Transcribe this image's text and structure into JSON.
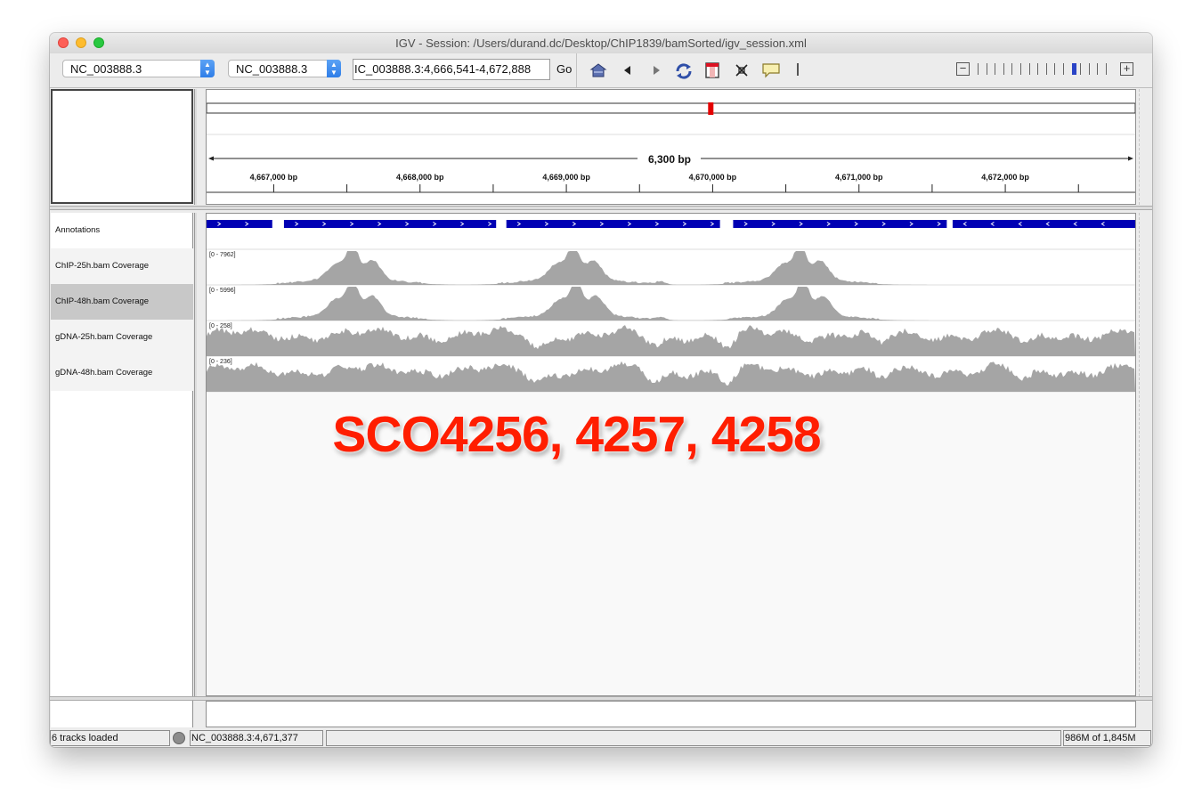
{
  "window": {
    "title": "IGV - Session: /Users/durand.dc/Desktop/ChIP1839/bamSorted/igv_session.xml"
  },
  "toolbar": {
    "genome_select": "NC_003888.3",
    "chromosome_select": "NC_003888.3",
    "locus_value": "IC_003888.3:4,666,541-4,672,888",
    "go_label": "Go",
    "icons": [
      "home-icon",
      "back-icon",
      "forward-icon",
      "refresh-icon",
      "roi-icon",
      "resize-icon",
      "popup-icon"
    ],
    "zoom": {
      "levels": 16,
      "current": 12,
      "minus": "−",
      "plus": "+"
    }
  },
  "ruler": {
    "span_label": "6,300 bp",
    "ticks": [
      {
        "label": "4,667,000 bp",
        "value": 4667000
      },
      {
        "label": "4,668,000 bp",
        "value": 4668000
      },
      {
        "label": "4,669,000 bp",
        "value": 4669000
      },
      {
        "label": "4,670,000 bp",
        "value": 4670000
      },
      {
        "label": "4,671,000 bp",
        "value": 4671000
      },
      {
        "label": "4,672,000 bp",
        "value": 4672000
      }
    ],
    "start": 4666541,
    "end": 4672888,
    "ideogram_marker_fraction": 0.543
  },
  "tracks": [
    {
      "name": "Annotations",
      "type": "annotation"
    },
    {
      "name": "ChIP-25h.bam Coverage",
      "type": "coverage",
      "range": "[0 - 7962]",
      "peaks": [
        4667540,
        4669050,
        4670600
      ]
    },
    {
      "name": "ChIP-48h.bam Coverage",
      "type": "coverage",
      "range": "[0 - 5996]",
      "peaks": [
        4667540,
        4669070,
        4670620
      ]
    },
    {
      "name": "gDNA-25h.bam Coverage",
      "type": "genomic",
      "range": "[0 - 258]"
    },
    {
      "name": "gDNA-48h.bam Coverage",
      "type": "genomic",
      "range": "[0 - 236]"
    }
  ],
  "genes": [
    {
      "start": 4666541,
      "end": 4666990,
      "strand": "+"
    },
    {
      "start": 4667070,
      "end": 4668520,
      "strand": "+"
    },
    {
      "start": 4668590,
      "end": 4670050,
      "strand": "+"
    },
    {
      "start": 4670140,
      "end": 4671600,
      "strand": "+"
    },
    {
      "start": 4671640,
      "end": 4672888,
      "strand": "-"
    }
  ],
  "overlay_label": "SCO4256, 4257, 4258",
  "status": {
    "tracks_loaded": "6 tracks loaded",
    "position": "NC_003888.3:4,671,377",
    "message": "",
    "memory": "986M of 1,845M"
  }
}
